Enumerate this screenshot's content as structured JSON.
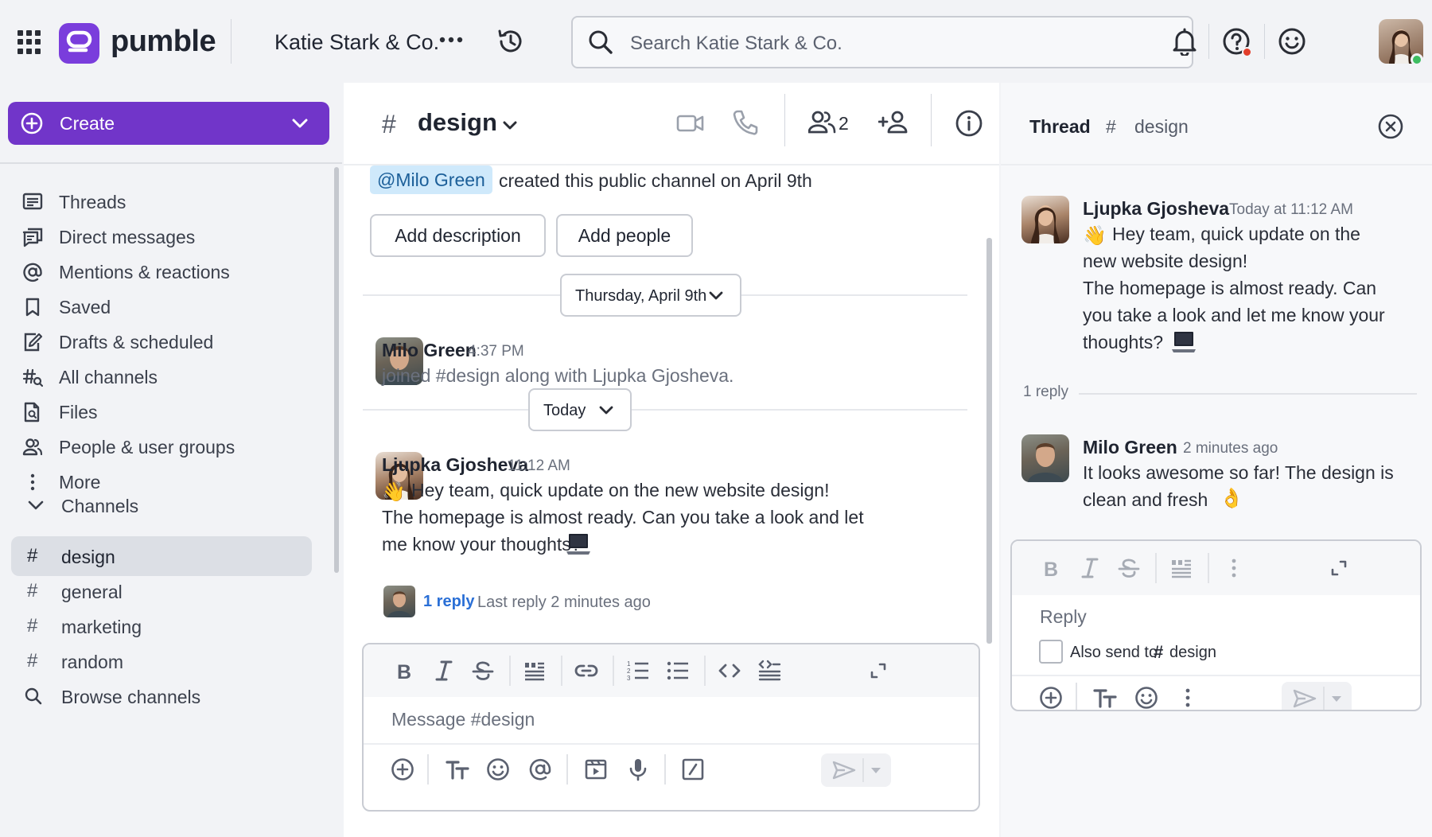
{
  "app": {
    "brand": "pumble",
    "workspace": "Katie Stark & Co."
  },
  "search": {
    "placeholder": "Search Katie Stark & Co."
  },
  "sidebar": {
    "create_label": "Create",
    "nav": [
      {
        "label": "Threads",
        "icon": "threads-icon"
      },
      {
        "label": "Direct messages",
        "icon": "direct-messages-icon"
      },
      {
        "label": "Mentions & reactions",
        "icon": "at-icon"
      },
      {
        "label": "Saved",
        "icon": "bookmark-icon"
      },
      {
        "label": "Drafts & scheduled",
        "icon": "drafts-icon"
      },
      {
        "label": "All channels",
        "icon": "channels-icon"
      },
      {
        "label": "Files",
        "icon": "files-icon"
      },
      {
        "label": "People & user groups",
        "icon": "people-icon"
      },
      {
        "label": "More",
        "icon": "more-vertical-icon"
      }
    ],
    "channels_header": "Channels",
    "channels": [
      {
        "name": "design",
        "active": true
      },
      {
        "name": "general",
        "active": false
      },
      {
        "name": "marketing",
        "active": false
      },
      {
        "name": "random",
        "active": false
      }
    ],
    "browse_label": "Browse channels"
  },
  "channel": {
    "hash": "#",
    "name": "design",
    "member_count": "2",
    "intro_mention": "@Milo Green",
    "intro_text": "created this public channel on April 9th",
    "add_description": "Add description",
    "add_people": "Add people",
    "day1": "Thursday, April 9th",
    "day2": "Today",
    "messages": [
      {
        "author": "Milo Green",
        "time": "4:37 PM",
        "text": "joined #design along with Ljupka Gjosheva."
      },
      {
        "author": "Ljupka Gjosheva",
        "time": "11:12 AM",
        "line1": "Hey team, quick update on the new website design!",
        "line2": "The homepage is almost ready. Can you take a look and let",
        "line3": "me know your thoughts?",
        "reply_link": "1 reply",
        "last_reply": "Last reply 2 minutes ago"
      }
    ],
    "composer_placeholder": "Message #design"
  },
  "thread": {
    "title": "Thread",
    "hash": "#",
    "channel": "design",
    "parent": {
      "author": "Ljupka Gjosheva",
      "time": "Today at 11:12 AM",
      "line1": "Hey team, quick update on the",
      "line2": "new website design!",
      "line3": "The homepage is almost ready. Can",
      "line4": "you take a look and let me know your",
      "line5": "thoughts?"
    },
    "reply_count": "1 reply",
    "reply": {
      "author": "Milo Green",
      "time": "2 minutes ago",
      "line1": "It looks awesome so far! The design is",
      "line2": "clean and fresh"
    },
    "composer_placeholder": "Reply",
    "also_send_label": "Also send to",
    "also_send_hash": "#",
    "also_send_channel": "design"
  },
  "colors": {
    "accent": "#7135c9",
    "link": "#2a6fd6",
    "mention_bg": "#cfe9fb",
    "online": "#3dbd61",
    "alert": "#e23e2b"
  }
}
